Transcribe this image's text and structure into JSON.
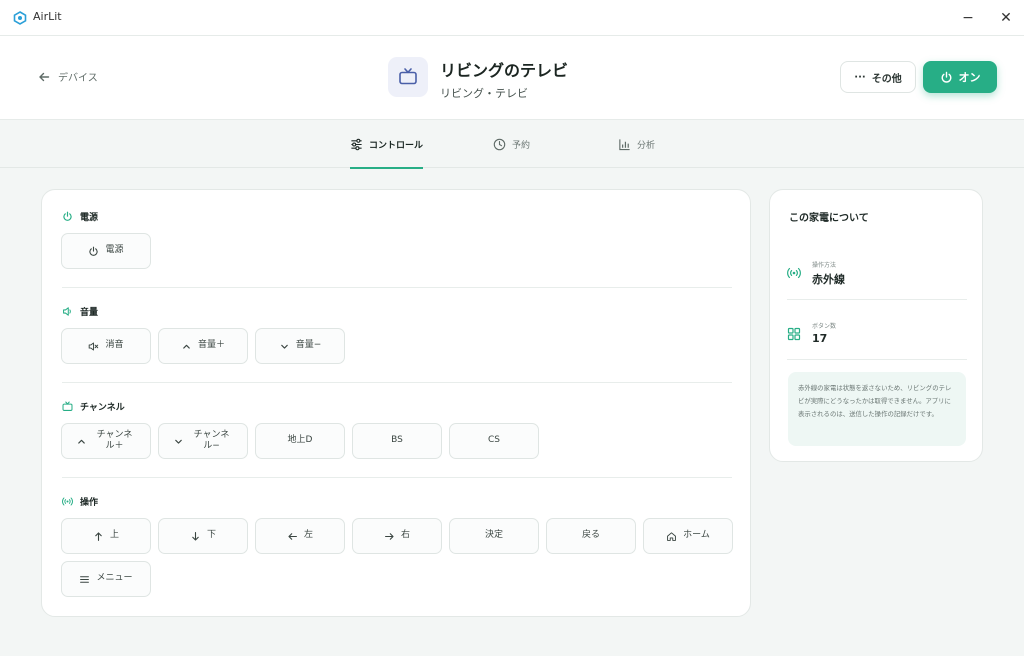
{
  "app": {
    "title": "AirLit",
    "minimize": "−",
    "close": "✕"
  },
  "header": {
    "back_label": "デバイス",
    "device_name": "リビングのテレビ",
    "device_subtitle": "リビング・テレビ",
    "more_label": "その他",
    "power_label": "オン"
  },
  "tabs": [
    {
      "label": "コントロール",
      "active": true
    },
    {
      "label": "予約",
      "active": false
    },
    {
      "label": "分析",
      "active": false
    }
  ],
  "sections": {
    "power": {
      "title": "電源",
      "buttons": [
        "電源"
      ]
    },
    "volume": {
      "title": "音量",
      "buttons": [
        "消音",
        "音量＋",
        "音量−"
      ]
    },
    "channel": {
      "title": "チャンネル",
      "buttons": [
        "チャンネル＋",
        "チャンネル−",
        "地上D",
        "BS",
        "CS"
      ]
    },
    "operation": {
      "title": "操作",
      "buttons": [
        "上",
        "下",
        "左",
        "右",
        "決定",
        "戻る",
        "ホーム",
        "メニュー"
      ]
    }
  },
  "about": {
    "title": "この家電について",
    "method_label": "操作方法",
    "method_value": "赤外線",
    "buttons_label": "ボタン数",
    "buttons_value": "17",
    "note": "赤外線の家電は状態を返さないため、リビングのテレビが実際にどうなったかは取得できません。アプリに表示されるのは、送信した操作の記録だけです。"
  },
  "colors": {
    "accent": "#27ae86",
    "icon_bg": "#eef0f9",
    "icon_fg": "#4a5fa8"
  },
  "icons": {
    "back": "arrow-left-icon",
    "device": "tv-icon",
    "more": "ellipsis-icon",
    "power": "power-icon",
    "controls_tab": "sliders-icon",
    "schedule_tab": "clock-icon",
    "analytics_tab": "bar-chart-icon"
  }
}
